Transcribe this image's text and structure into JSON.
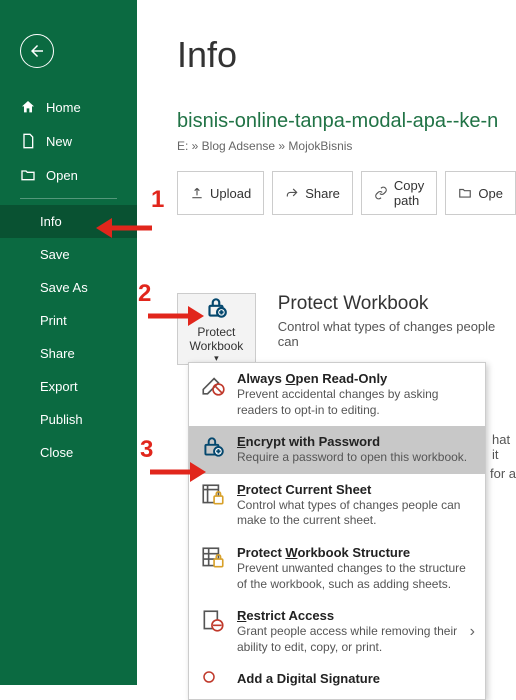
{
  "titlebar": "bisnis-online-tanpa-moda",
  "sidebar": {
    "home": "Home",
    "new": "New",
    "open": "Open",
    "info": "Info",
    "save": "Save",
    "saveas": "Save As",
    "print": "Print",
    "share": "Share",
    "export": "Export",
    "publish": "Publish",
    "close": "Close"
  },
  "page": {
    "title": "Info",
    "doc_title": "bisnis-online-tanpa-modal-apa--ke-n",
    "breadcrumb": "E: » Blog Adsense » MojokBisnis"
  },
  "buttons": {
    "upload": "Upload",
    "share": "Share",
    "copypath": "Copy path",
    "open": "Ope"
  },
  "protect": {
    "btn": "Protect Workbook",
    "heading": "Protect Workbook",
    "desc": "Control what types of changes people can"
  },
  "menu": {
    "items": [
      {
        "title": "Always Open Read-Only",
        "ul": "O",
        "desc": "Prevent accidental changes by asking readers to opt-in to editing."
      },
      {
        "title": "Encrypt with Password",
        "ul": "E",
        "desc": "Require a password to open this workbook."
      },
      {
        "title": "Protect Current Sheet",
        "ul": "P",
        "desc": "Control what types of changes people can make to the current sheet."
      },
      {
        "title": "Protect Workbook Structure",
        "ul": "W",
        "desc": "Prevent unwanted changes to the structure of the workbook, such as adding sheets."
      },
      {
        "title": "Restrict Access",
        "ul": "R",
        "desc": "Grant people access while removing their ability to edit, copy, or print."
      },
      {
        "title": "Add a Digital Signature",
        "ul": "",
        "desc": ""
      }
    ]
  },
  "side": {
    "hat": "hat it",
    "fora": "for a"
  },
  "annotations": {
    "n1": "1",
    "n2": "2",
    "n3": "3"
  }
}
